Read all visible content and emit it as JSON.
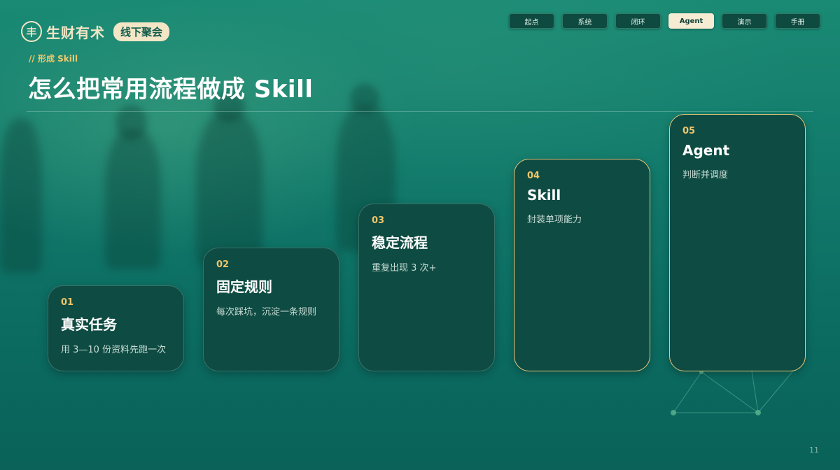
{
  "brand": {
    "mark": "丰",
    "name": "生财有术",
    "badge": "线下聚会"
  },
  "nav": {
    "tabs": [
      "起点",
      "系统",
      "闭环",
      "Agent",
      "演示",
      "手册"
    ],
    "active": "Agent"
  },
  "header": {
    "kicker": "// 形成 Skill",
    "title": "怎么把常用流程做成 Skill"
  },
  "steps": [
    {
      "num": "01",
      "title": "真实任务",
      "desc": "用 3—10 份资料先跑一次"
    },
    {
      "num": "02",
      "title": "固定规则",
      "desc": "每次踩坑，沉淀一条规则"
    },
    {
      "num": "03",
      "title": "稳定流程",
      "desc": "重复出现 3 次+"
    },
    {
      "num": "04",
      "title": "Skill",
      "desc": "封装单项能力"
    },
    {
      "num": "05",
      "title": "Agent",
      "desc": "判断并调度"
    }
  ],
  "colors": {
    "accent": "#f0c66b",
    "card": "#0e4b42",
    "highlight_border": "#e7c778",
    "background": "#11786a"
  },
  "page_number": "11"
}
